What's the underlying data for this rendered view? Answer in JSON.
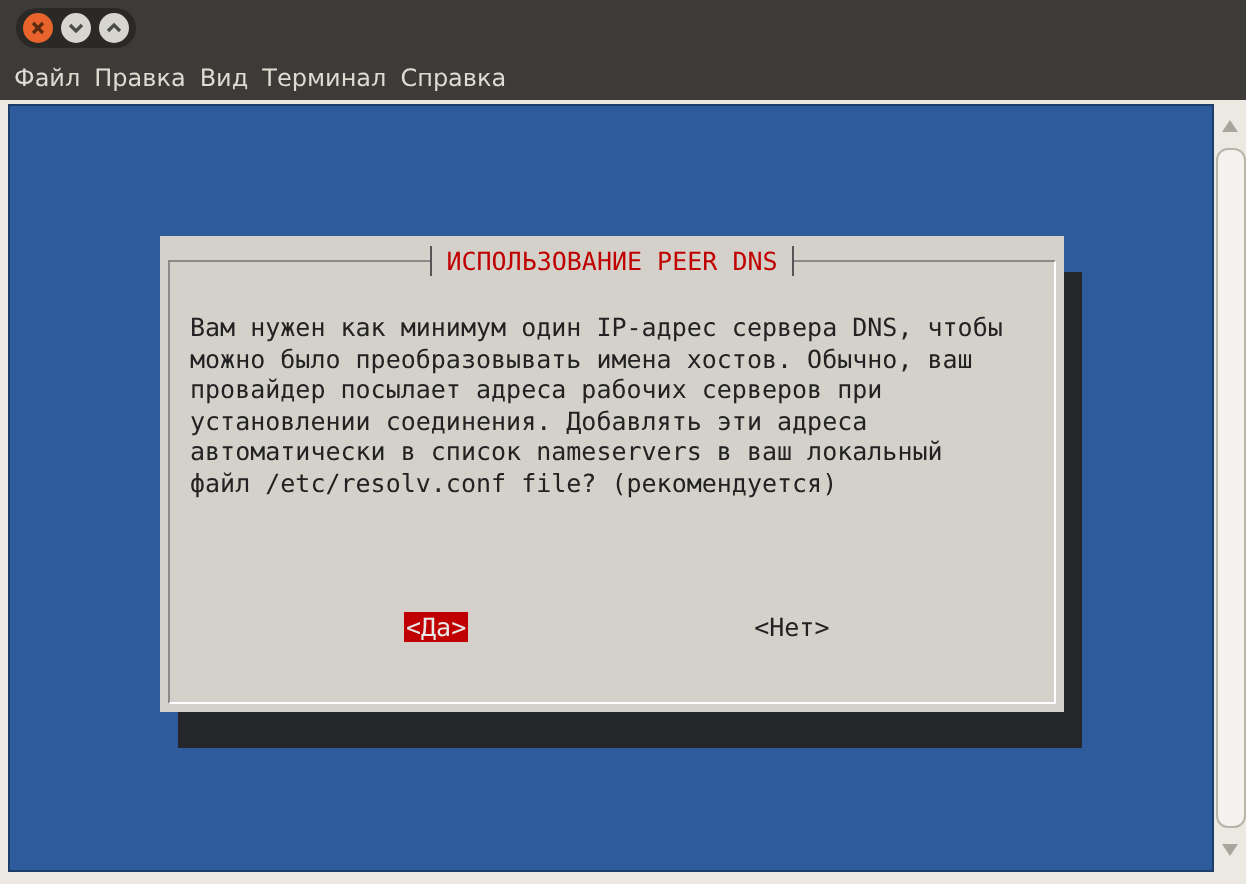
{
  "menu": [
    "Файл",
    "Правка",
    "Вид",
    "Терминал",
    "Справка"
  ],
  "dialog": {
    "title": "ИСПОЛЬЗОВАНИЕ PEER DNS",
    "message": "Вам нужен как минимум один IP-адрес сервера DNS, чтобы\nможно было преобразовывать имена хостов. Обычно, ваш\nпровайдер посылает адреса рабочих серверов при\nустановлении соединения. Добавлять эти адреса\nавтоматически в список nameservers в ваш локальный\nфайл /etc/resolv.conf file? (рекомендуется)",
    "buttons": [
      {
        "label": "<Да>",
        "selected": true
      },
      {
        "label": "<Нет>",
        "selected": false
      }
    ]
  }
}
